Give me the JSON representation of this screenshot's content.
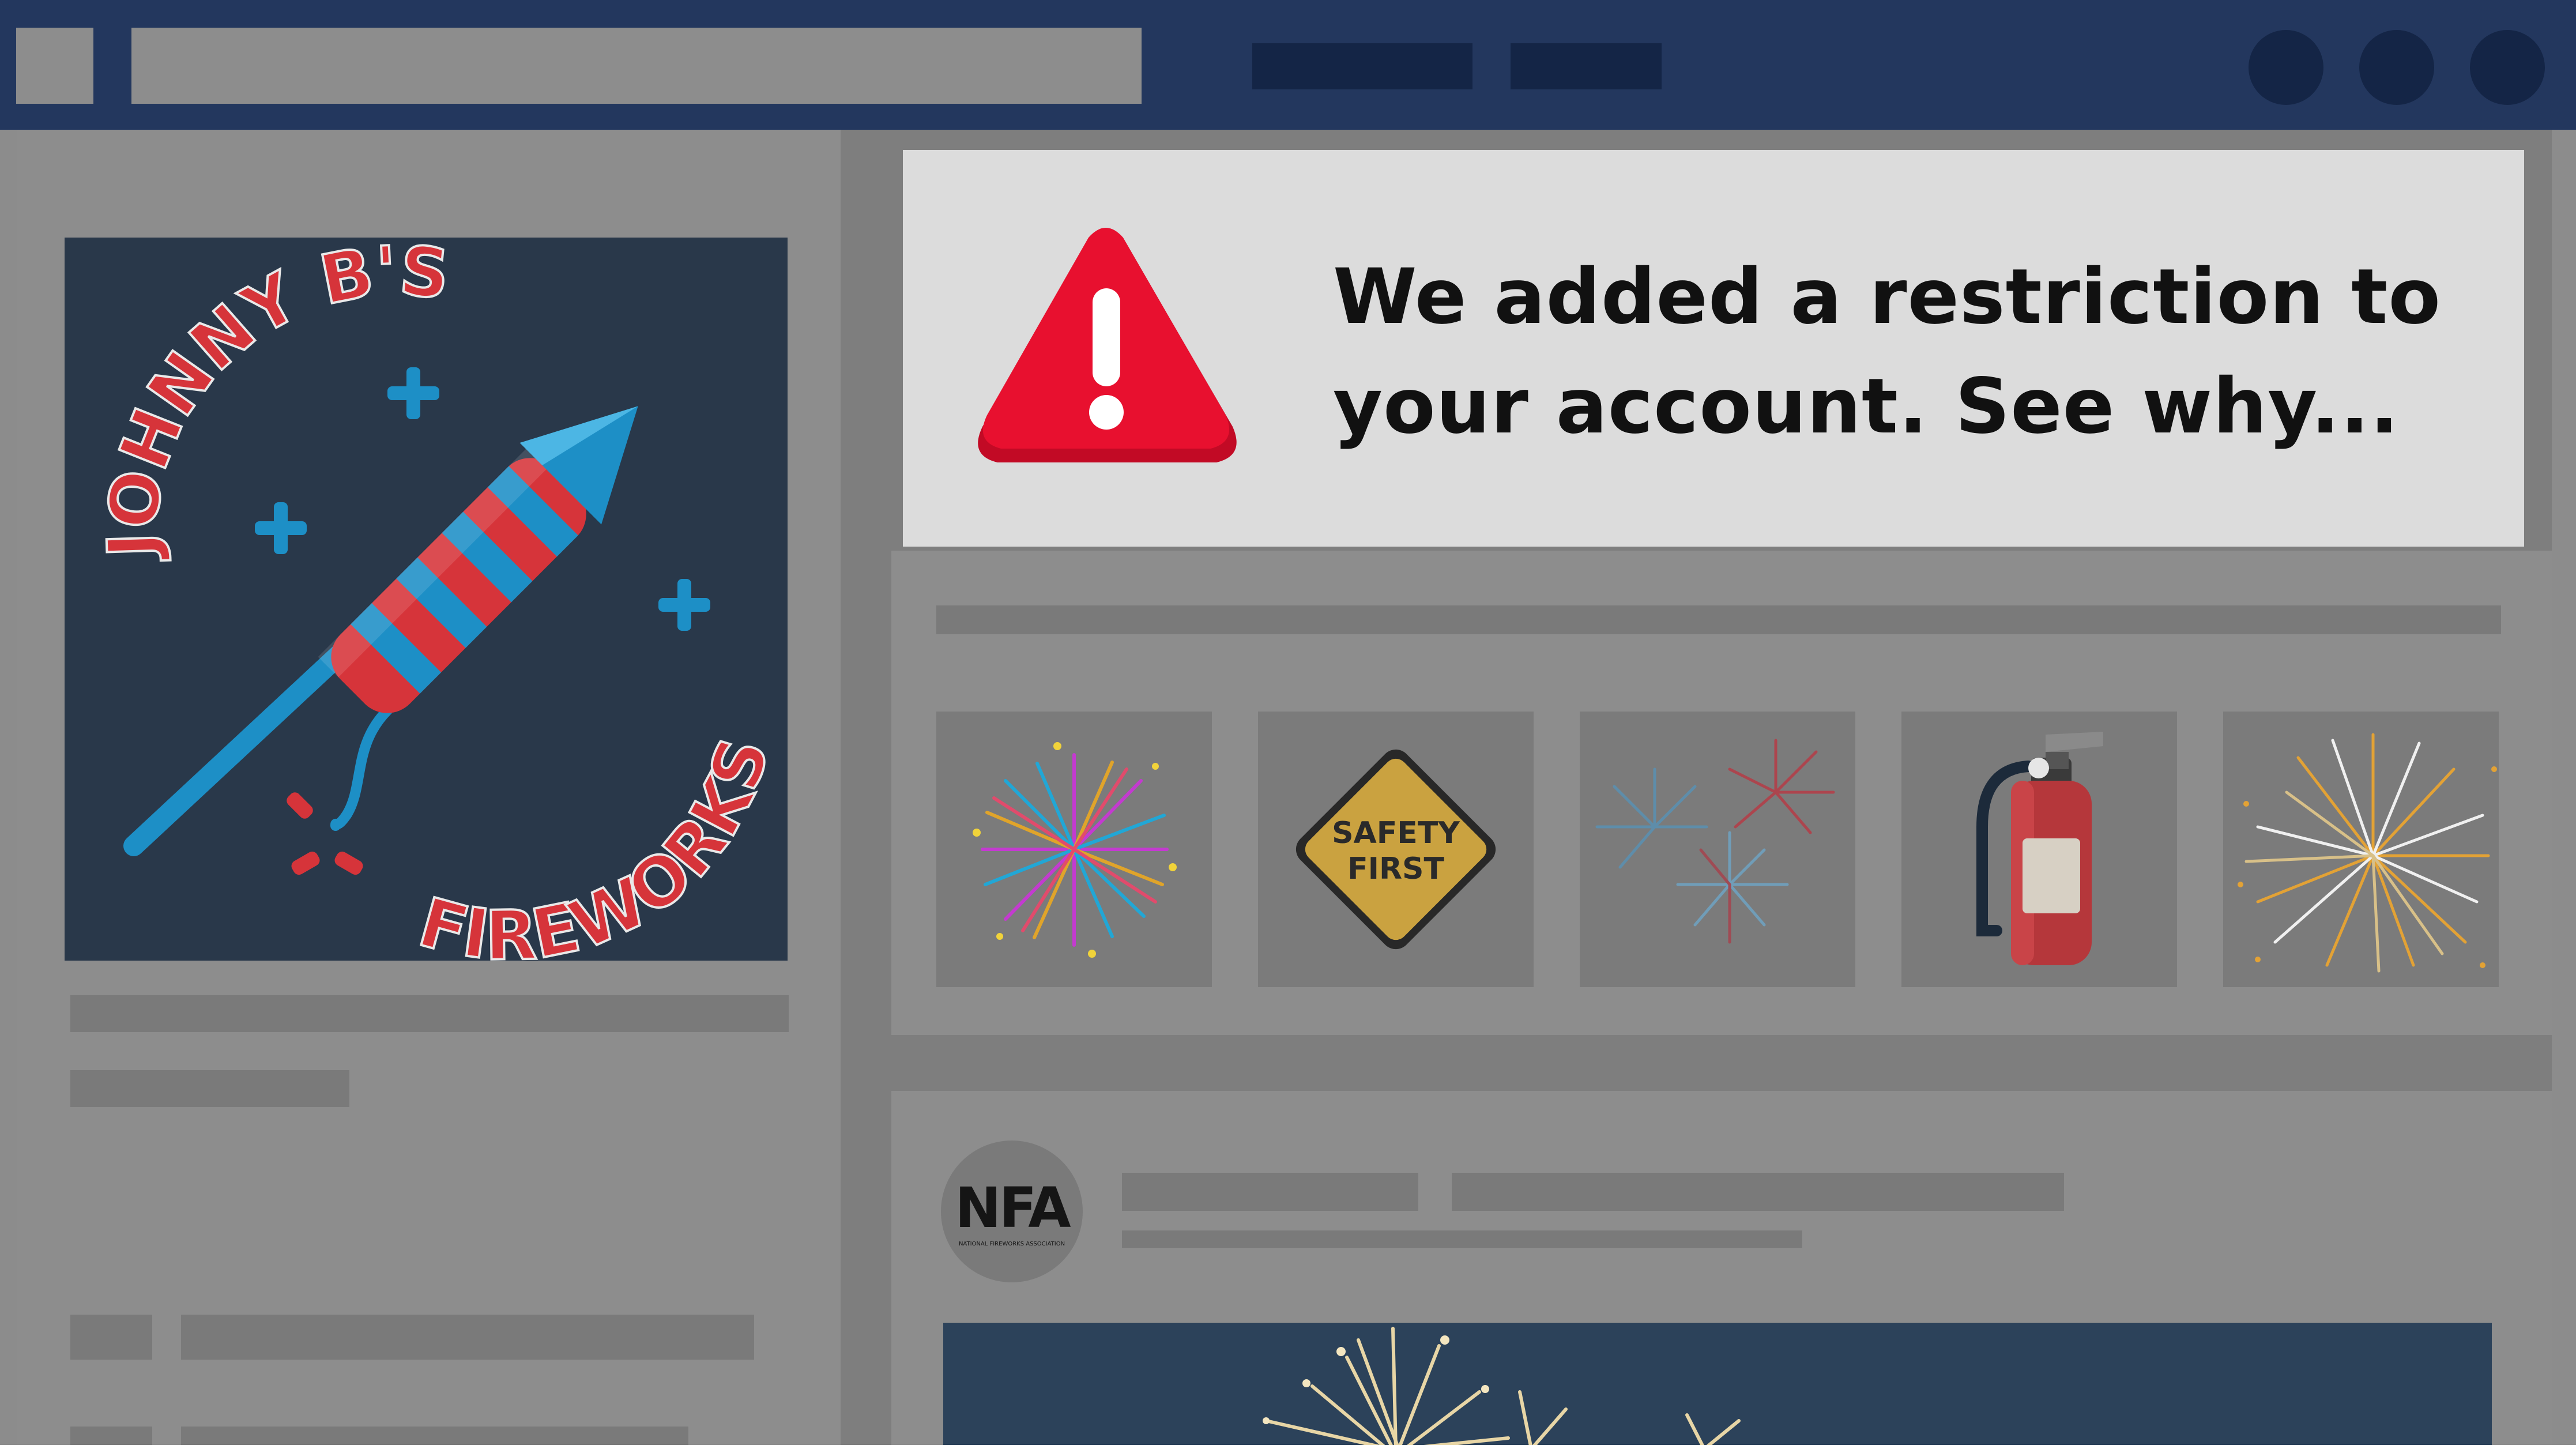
{
  "banner": {
    "message": "We added a restriction to your account. See why...",
    "icon": "warning-triangle-icon",
    "accent": "#e8102f"
  },
  "page_logo": {
    "brand_top": "JOHNNY B'S",
    "brand_bottom": "FIREWORKS",
    "icon": "firework-rocket-icon",
    "colors": {
      "background": "#29384a",
      "red": "#d6343a",
      "blue": "#1d8fc6"
    }
  },
  "gallery": {
    "items": [
      {
        "name": "colorful-firework-burst",
        "icon": "firework-burst-icon"
      },
      {
        "name": "safety-first-sign",
        "icon": "safety-sign-icon",
        "label": "SAFETY FIRST"
      },
      {
        "name": "red-blue-fireworks",
        "icon": "firework-burst-icon"
      },
      {
        "name": "fire-extinguisher",
        "icon": "fire-extinguisher-icon"
      },
      {
        "name": "gold-firework-burst",
        "icon": "firework-burst-icon"
      }
    ]
  },
  "post": {
    "avatar_text": "NFA",
    "avatar_subtitle": "NATIONAL FIREWORKS ASSOCIATION",
    "image": "sparkler-photo"
  },
  "colors": {
    "topbar": "#23375e",
    "topbar_dark": "#142546",
    "overlay_gray": "#8d8d8d"
  }
}
